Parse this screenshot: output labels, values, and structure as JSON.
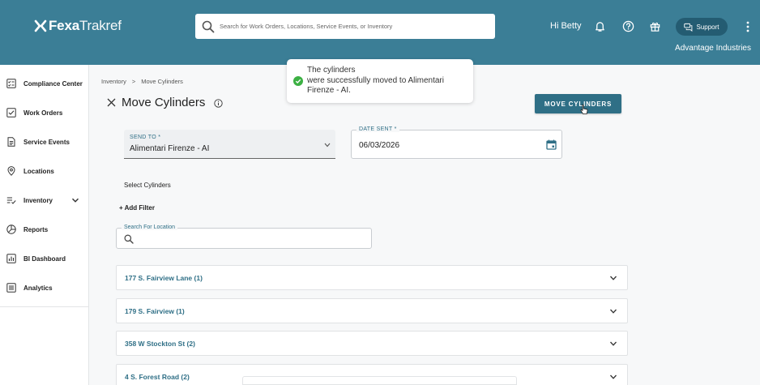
{
  "header": {
    "logo_bold": "Fexa",
    "logo_light": "Trakref",
    "search_placeholder": "Search for Work Orders, Locations, Service Events, or Inventory",
    "greeting": "Hi Betty",
    "support_label": "Support",
    "organization": "Advantage Industries"
  },
  "sidebar": {
    "items": [
      {
        "label": "Compliance Center",
        "icon": "compliance-icon"
      },
      {
        "label": "Work Orders",
        "icon": "checkbox-icon"
      },
      {
        "label": "Service Events",
        "icon": "document-icon"
      },
      {
        "label": "Locations",
        "icon": "location-pin-icon"
      },
      {
        "label": "Inventory",
        "icon": "inventory-list-icon"
      },
      {
        "label": "Reports",
        "icon": "pie-chart-icon"
      },
      {
        "label": "BI Dashboard",
        "icon": "bar-chart-icon"
      },
      {
        "label": "Analytics",
        "icon": "analytics-icon"
      }
    ]
  },
  "breadcrumb": {
    "root": "Inventory",
    "separator": ">",
    "current": "Move Cylinders"
  },
  "page": {
    "title": "Move Cylinders",
    "primary_button": "MOVE CYLINDERS"
  },
  "toast": {
    "message": "The cylinders\nwere successfully moved to Alimentari Firenze - AI."
  },
  "form": {
    "send_to_label": "SEND TO *",
    "send_to_value": "Alimentari Firenze - AI",
    "date_sent_label": "DATE SENT *",
    "date_sent_value": "06/03/2026",
    "select_cylinders_label": "Select Cylinders",
    "add_filter_label": "+ Add Filter",
    "location_search_label": "Search For Location"
  },
  "locations": [
    {
      "label": "177 S. Fairview Lane (1)"
    },
    {
      "label": "179 S. Fairview (1)"
    },
    {
      "label": "358 W Stockton St (2)"
    },
    {
      "label": "4 S. Forest Road (2)"
    }
  ],
  "colors": {
    "header_bg": "#3b7e96",
    "primary": "#2f6f86",
    "success": "#3cb043"
  }
}
